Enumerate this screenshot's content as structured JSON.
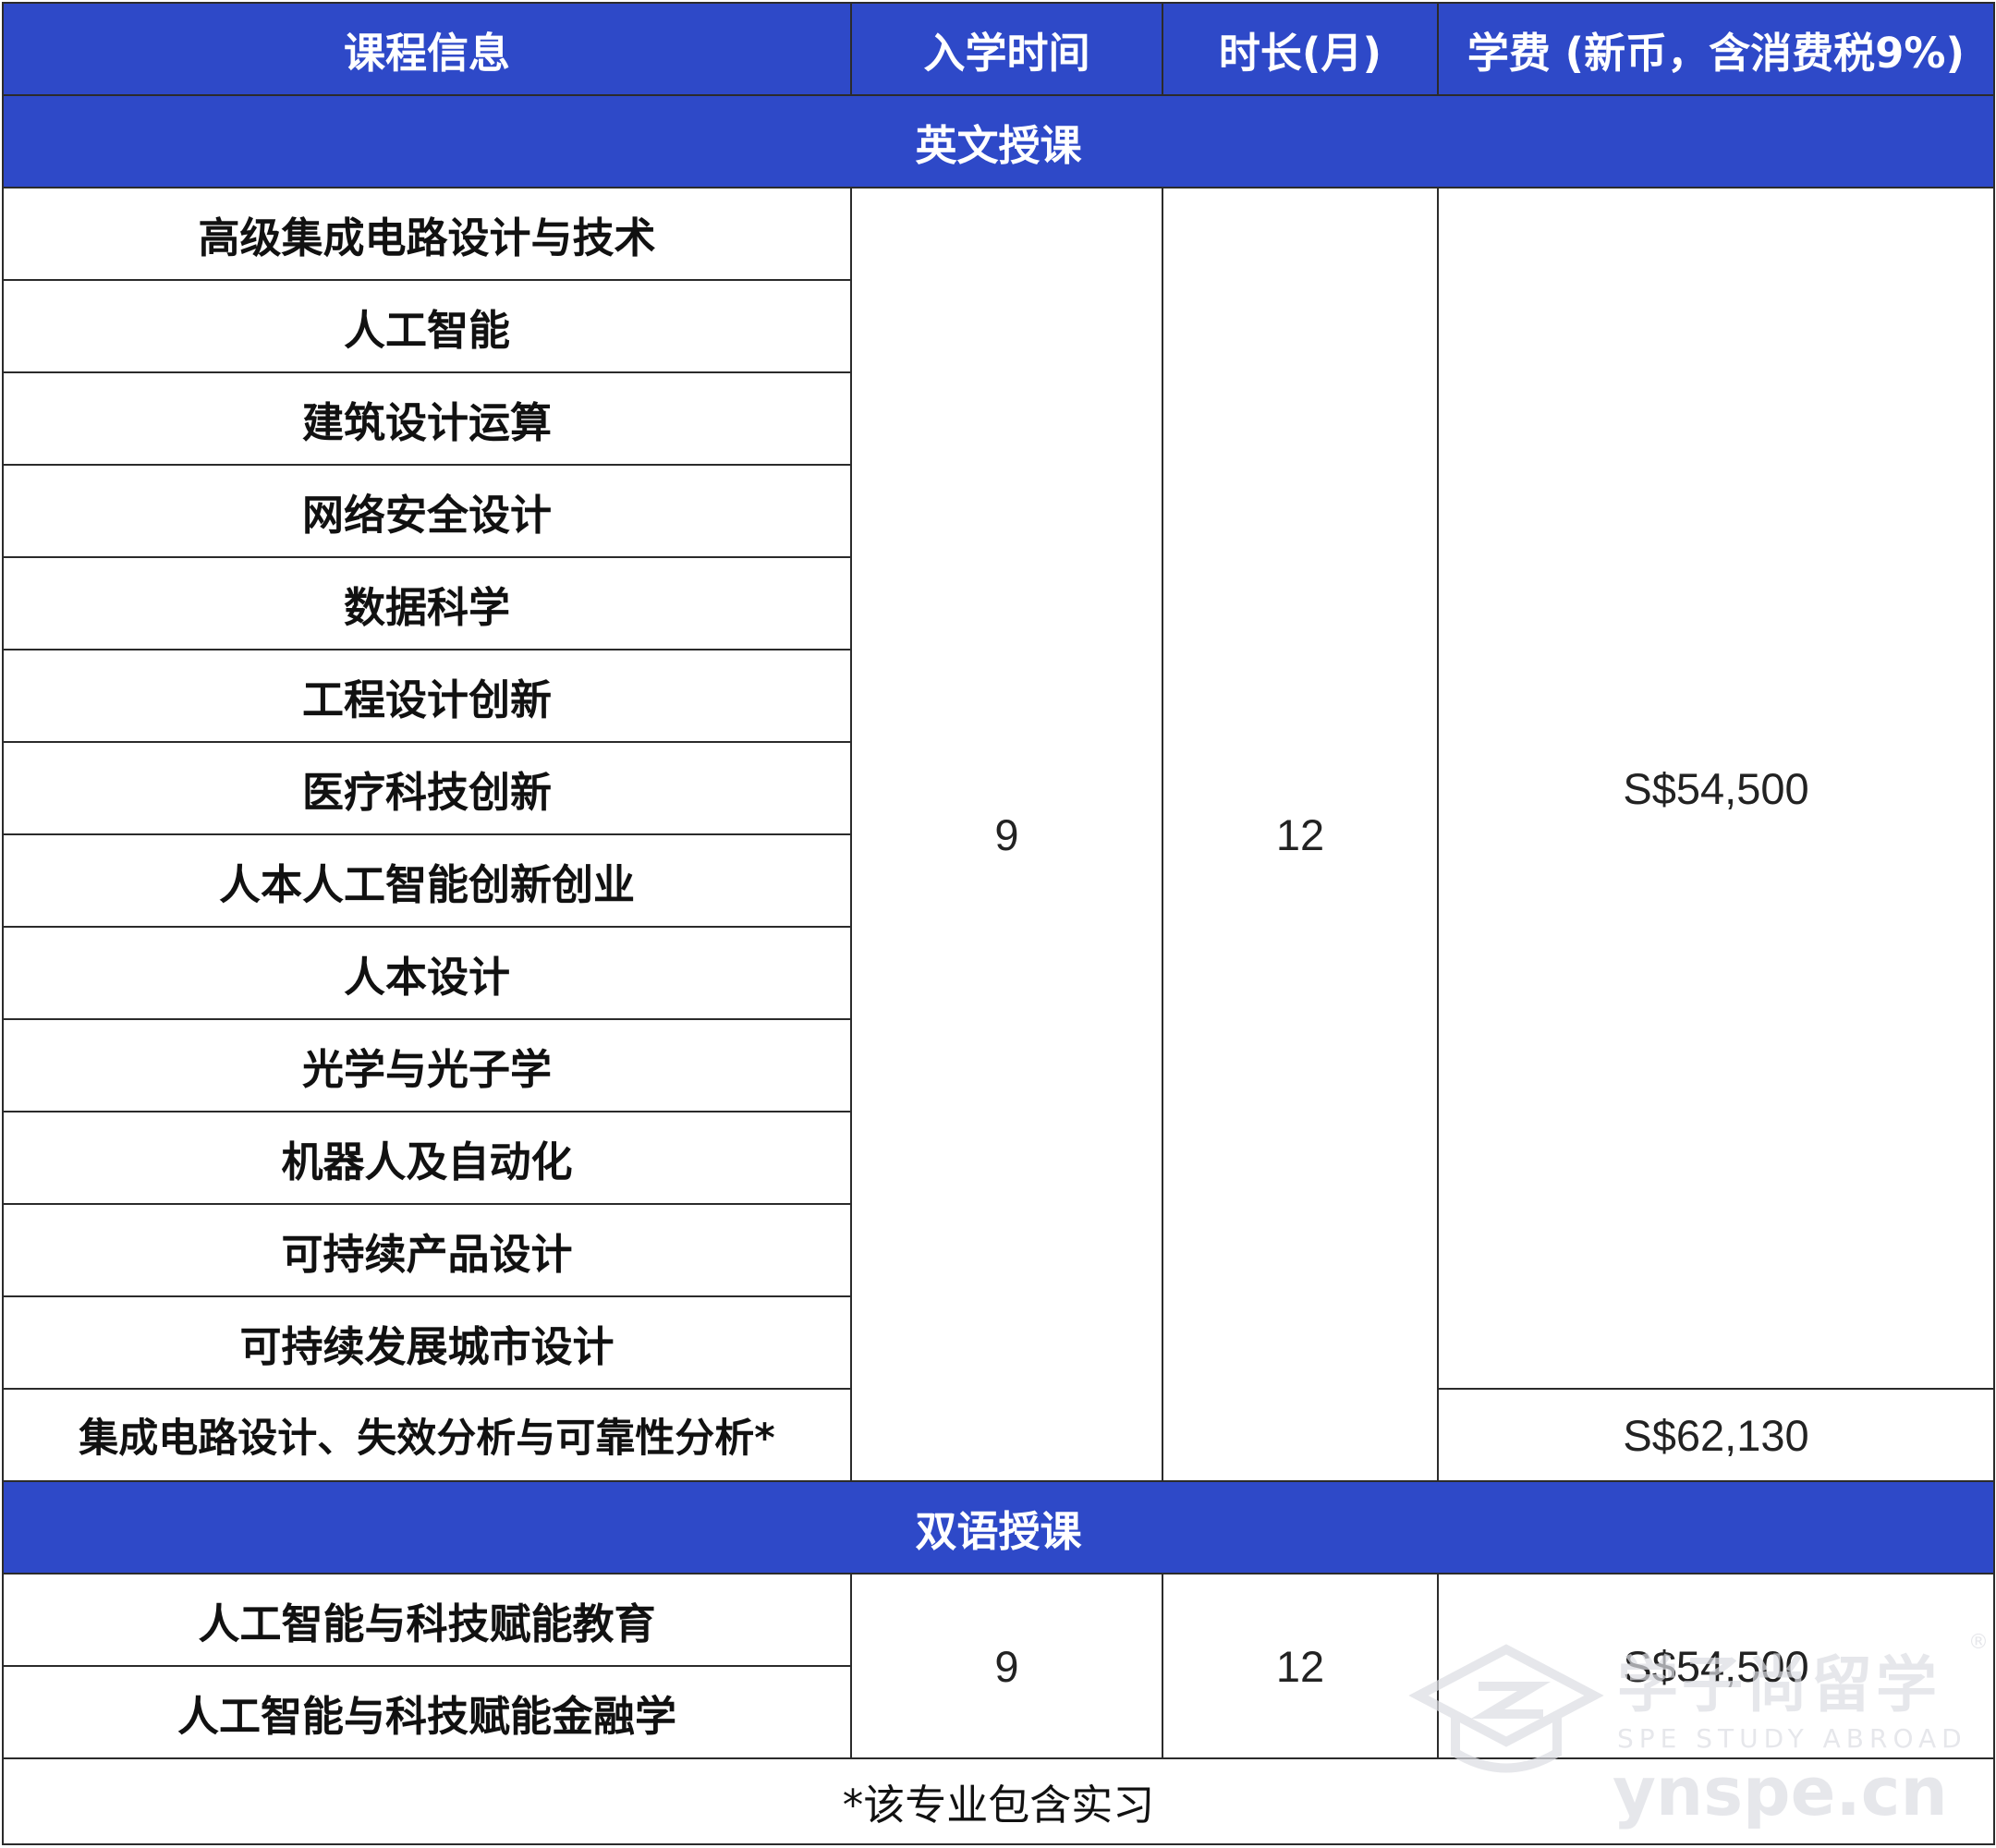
{
  "header": {
    "course": "课程信息",
    "intake": "入学时间",
    "duration": "时长(月)",
    "fee": "学费 (新币，含消费税9%)"
  },
  "sections": [
    {
      "title": "英文授课",
      "intake": "9",
      "duration": "12",
      "courses": [
        "高级集成电路设计与技术",
        "人工智能",
        "建筑设计运算",
        "网络安全设计",
        "数据科学",
        "工程设计创新",
        "医疗科技创新",
        "人本人工智能创新创业",
        "人本设计",
        "光学与光子学",
        "机器人及自动化",
        "可持续产品设计",
        "可持续发展城市设计",
        "集成电路设计、失效分析与可靠性分析*"
      ],
      "fees": [
        "S$54,500",
        "S$62,130"
      ]
    },
    {
      "title": "双语授课",
      "intake": "9",
      "duration": "12",
      "courses": [
        "人工智能与科技赋能教育",
        "人工智能与科技赋能金融学"
      ],
      "fee": "S$54,500"
    }
  ],
  "footnote": "*该专业包含实习",
  "watermark": {
    "brand": "学子尚留学",
    "registered": "®",
    "subtitle": "SPE STUDY ABROAD",
    "url": "ynspe.cn"
  }
}
